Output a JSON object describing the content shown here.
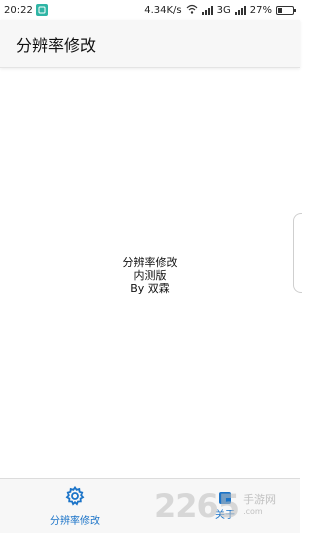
{
  "status_bar": {
    "time": "20:22",
    "speed": "4.34K/s",
    "network": "3G",
    "battery_percent": "27%",
    "battery_level": 0.27,
    "accent": "#2fb5a5"
  },
  "app_bar": {
    "title": "分辨率修改"
  },
  "content": {
    "line1": "分辨率修改",
    "line2": "内测版",
    "line3": "By 双霖"
  },
  "bottom_nav": {
    "items": [
      {
        "label": "分辨率修改",
        "icon": "gear-icon",
        "active": true
      },
      {
        "label": "关于",
        "icon": "info-icon",
        "active": false
      }
    ],
    "accent": "#1a73c8"
  },
  "watermark": {
    "logo": "2265",
    "title": "手游网",
    "url": ".com"
  }
}
